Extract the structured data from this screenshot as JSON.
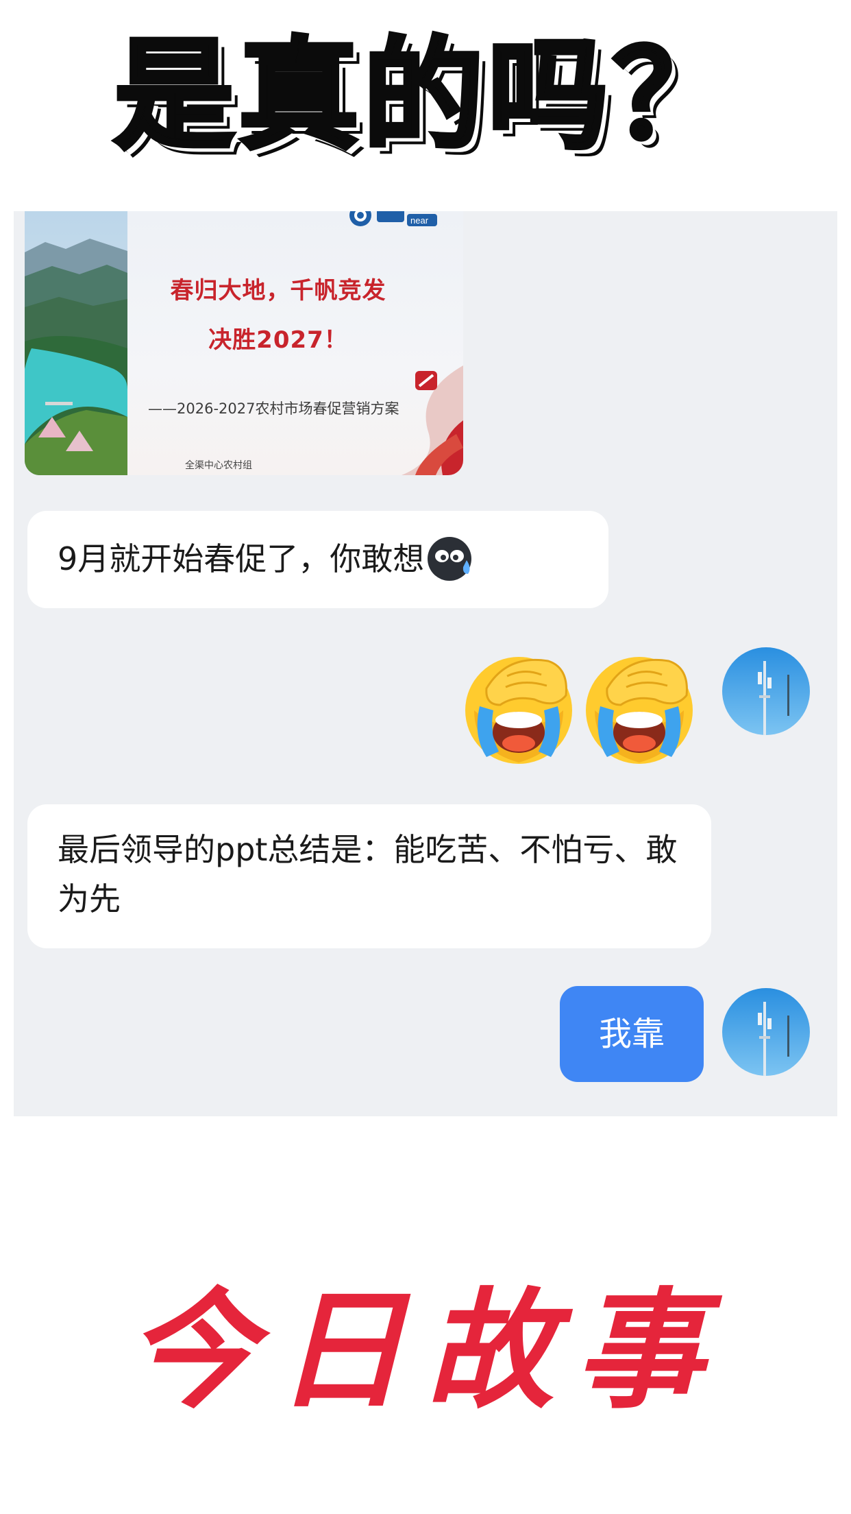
{
  "headline": "是真的吗？",
  "chat": {
    "image_message": {
      "poster_line1": "春归大地，千帆竞发",
      "poster_line2": "决胜2027！",
      "poster_subtitle": "——2026-2027农村市场春促营销方案",
      "poster_footer": "全渠中心农村组",
      "poster_logo_text": "near"
    },
    "messages": [
      {
        "side": "left",
        "text": "9月就开始春促了，你敢想",
        "emoji": "sweat-emoji"
      },
      {
        "side": "right",
        "emoji": [
          "facepalm-crying-emoji",
          "facepalm-crying-emoji"
        ]
      },
      {
        "side": "left",
        "text": "最后领导的ppt总结是：能吃苦、不怕亏、敢为先"
      },
      {
        "side": "right",
        "text": "我靠"
      }
    ]
  },
  "brand": "今日故事",
  "colors": {
    "panel_bg": "#eef0f3",
    "bubble_left": "#ffffff",
    "bubble_right": "#3f86f4",
    "brand_red": "#e5253b",
    "poster_red": "#c8242c"
  }
}
